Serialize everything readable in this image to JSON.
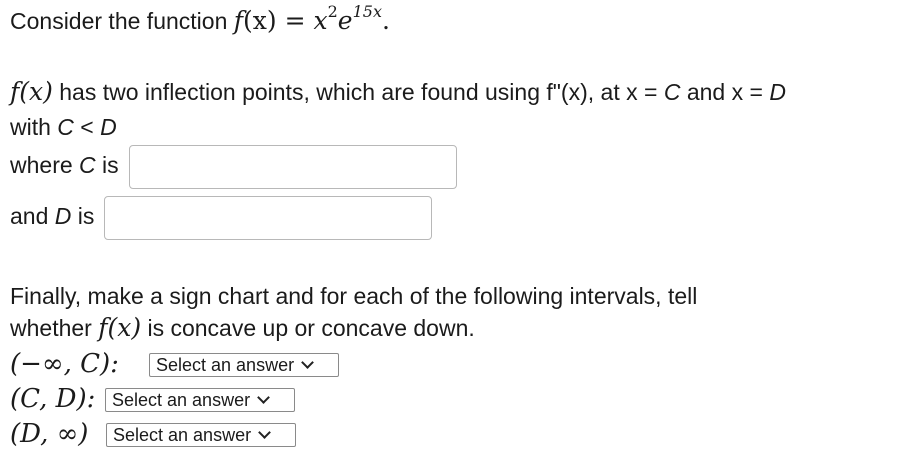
{
  "question": {
    "intro_text": "Consider the function",
    "func_name": "f",
    "func_arg": "(x)",
    "equals": "=",
    "base": "x",
    "base_exp": "2",
    "exp_base": "e",
    "exp_power": "15x",
    "period": "."
  },
  "inflection": {
    "func_label": "f(x)",
    "sentence_part1": " has two inflection points, which are found using f\"(x), at ",
    "x_eq_c": "x = ",
    "c_var": "C",
    "and_text": " and ",
    "x_eq_d": "x = ",
    "d_var": "D",
    "with_text": "with ",
    "c_lt_d_c": "C",
    "lt": " < ",
    "c_lt_d_d": "D"
  },
  "answers": {
    "where_text": "where ",
    "c_label_var": "C",
    "is_text": " is",
    "c_value": "",
    "and_text": "and ",
    "d_label_var": "D",
    "is_text2": " is",
    "d_value": ""
  },
  "sign_chart": {
    "line1": "Finally, make a sign chart and for each of the following intervals, tell",
    "line2_pre": "whether ",
    "line2_func": "f(x)",
    "line2_post": " is concave up or concave down.",
    "intervals": [
      {
        "label": "(−∞, C):",
        "selected": "Select an answer"
      },
      {
        "label": "(C, D):",
        "selected": "Select an answer"
      },
      {
        "label": "(D, ∞)",
        "selected": "Select an answer"
      }
    ]
  }
}
